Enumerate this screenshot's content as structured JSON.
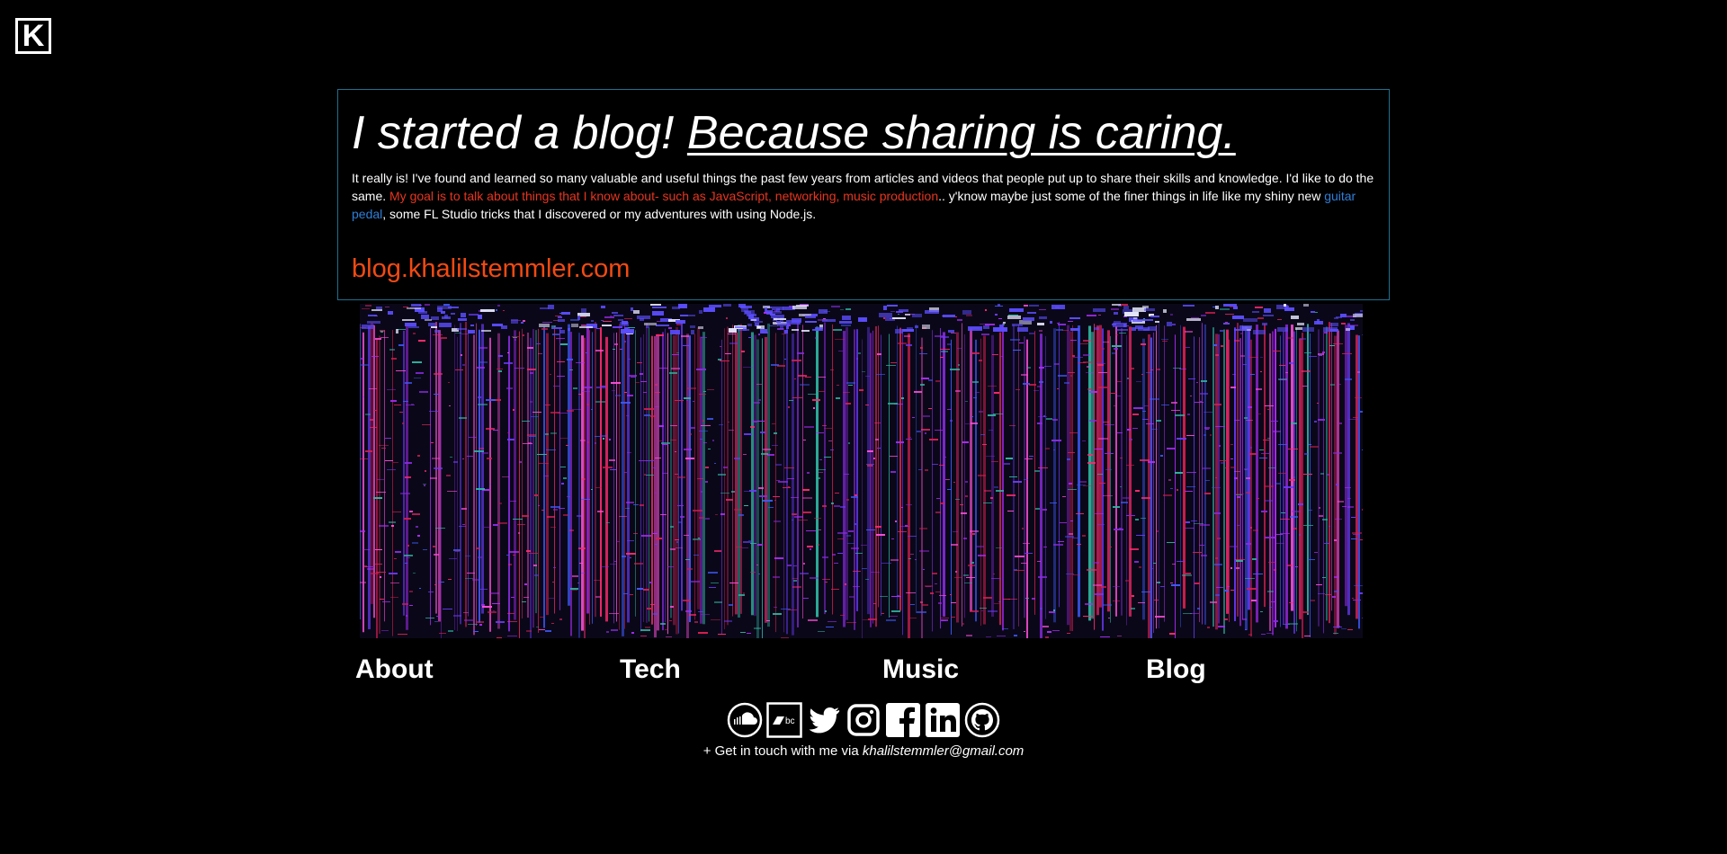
{
  "logo": {
    "letter": "K"
  },
  "hero": {
    "headline_plain": "I started a blog! ",
    "headline_emph": "Because sharing is caring.",
    "intro_1": "It really is! I've found and learned so many valuable and useful things the past few years from articles and videos that people put up to share their skills and knowledge. I'd like to do the same. ",
    "intro_red": "My goal is to talk about things that I know about- such as JavaScript, networking, music production",
    "intro_2": ".. y'know maybe just some of the finer things in life like my shiny new ",
    "intro_link": "guitar pedal",
    "intro_3": ", some FL Studio tricks that I discovered or my adventures with using Node.js.",
    "blog_url": "blog.khalilstemmler.com"
  },
  "nav": {
    "about": "About",
    "tech": "Tech",
    "music": "Music",
    "blog": "Blog"
  },
  "social": [
    "soundcloud-icon",
    "bandcamp-icon",
    "twitter-icon",
    "instagram-icon",
    "facebook-icon",
    "linkedin-icon",
    "github-icon"
  ],
  "contact": {
    "prefix": "+ Get in touch with me via ",
    "email": "khalilstemmler@gmail.com"
  },
  "colors": {
    "background": "#000000",
    "card_border": "#1f6f8f",
    "accent_red": "#e8351f",
    "blog_orange": "#f24a12",
    "link_blue": "#2f7fd8"
  }
}
